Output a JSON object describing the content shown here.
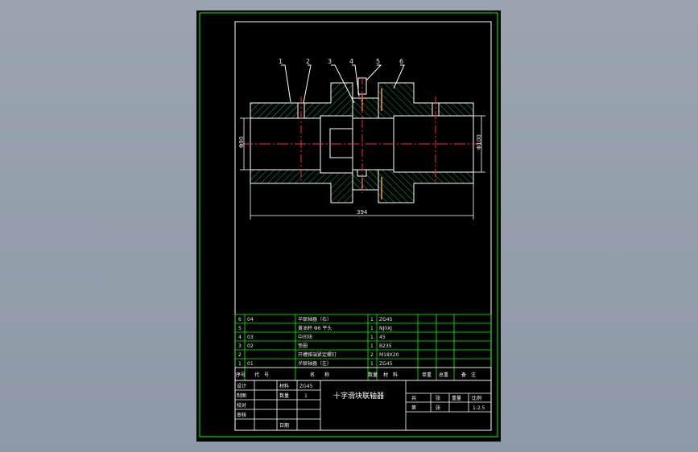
{
  "drawing": {
    "title": "十字滑块联轴器",
    "scale_value": "1:2.5",
    "dimensions": {
      "dia_left": "Φ90",
      "dia_right": "Φ100",
      "length": "394"
    },
    "balloons": [
      "1",
      "2",
      "3",
      "4",
      "5",
      "6"
    ]
  },
  "bom": {
    "rows": [
      {
        "no": "6",
        "code": "04",
        "name": "半联轴器（右）",
        "qty": "1",
        "material": "ZG45"
      },
      {
        "no": "5",
        "code": "",
        "name": "黄油杯 Φ6 平头",
        "qty": "1",
        "material": "NJ0XJ"
      },
      {
        "no": "4",
        "code": "03",
        "name": "中间块",
        "qty": "1",
        "material": "45"
      },
      {
        "no": "3",
        "code": "02",
        "name": "垫圈",
        "qty": "1",
        "material": "B235"
      },
      {
        "no": "2",
        "code": "",
        "name": "开槽锥端紧定螺钉",
        "qty": "2",
        "material": "M18X20"
      },
      {
        "no": "1",
        "code": "01",
        "name": "半联轴器（左）",
        "qty": "1",
        "material": "ZG45"
      }
    ],
    "header": {
      "no": "序号",
      "code": "代　号",
      "name": "名　　称",
      "qty": "数量",
      "material": "材　料",
      "unit_weight": "单重",
      "total_weight": "总重",
      "remark": "备　注"
    }
  },
  "title_block": {
    "design": "设计",
    "check": "制图",
    "review": "校对",
    "approve": "审核",
    "material_label": "材料",
    "material_value": "ZG45",
    "qty_label": "数量",
    "qty_value": "1",
    "date_label": "日期",
    "total_label": "共",
    "sheet_label": "张",
    "weight_label": "重量",
    "scale_label": "比例",
    "page_label": "第",
    "page_sheet_label": "张"
  },
  "colors": {
    "frame": "#00ff00",
    "outline": "#ffffff",
    "hatch": "#00b050",
    "centerline": "#ff2a2a",
    "hidden": "#ffa500",
    "text": "#e8e8e8"
  }
}
